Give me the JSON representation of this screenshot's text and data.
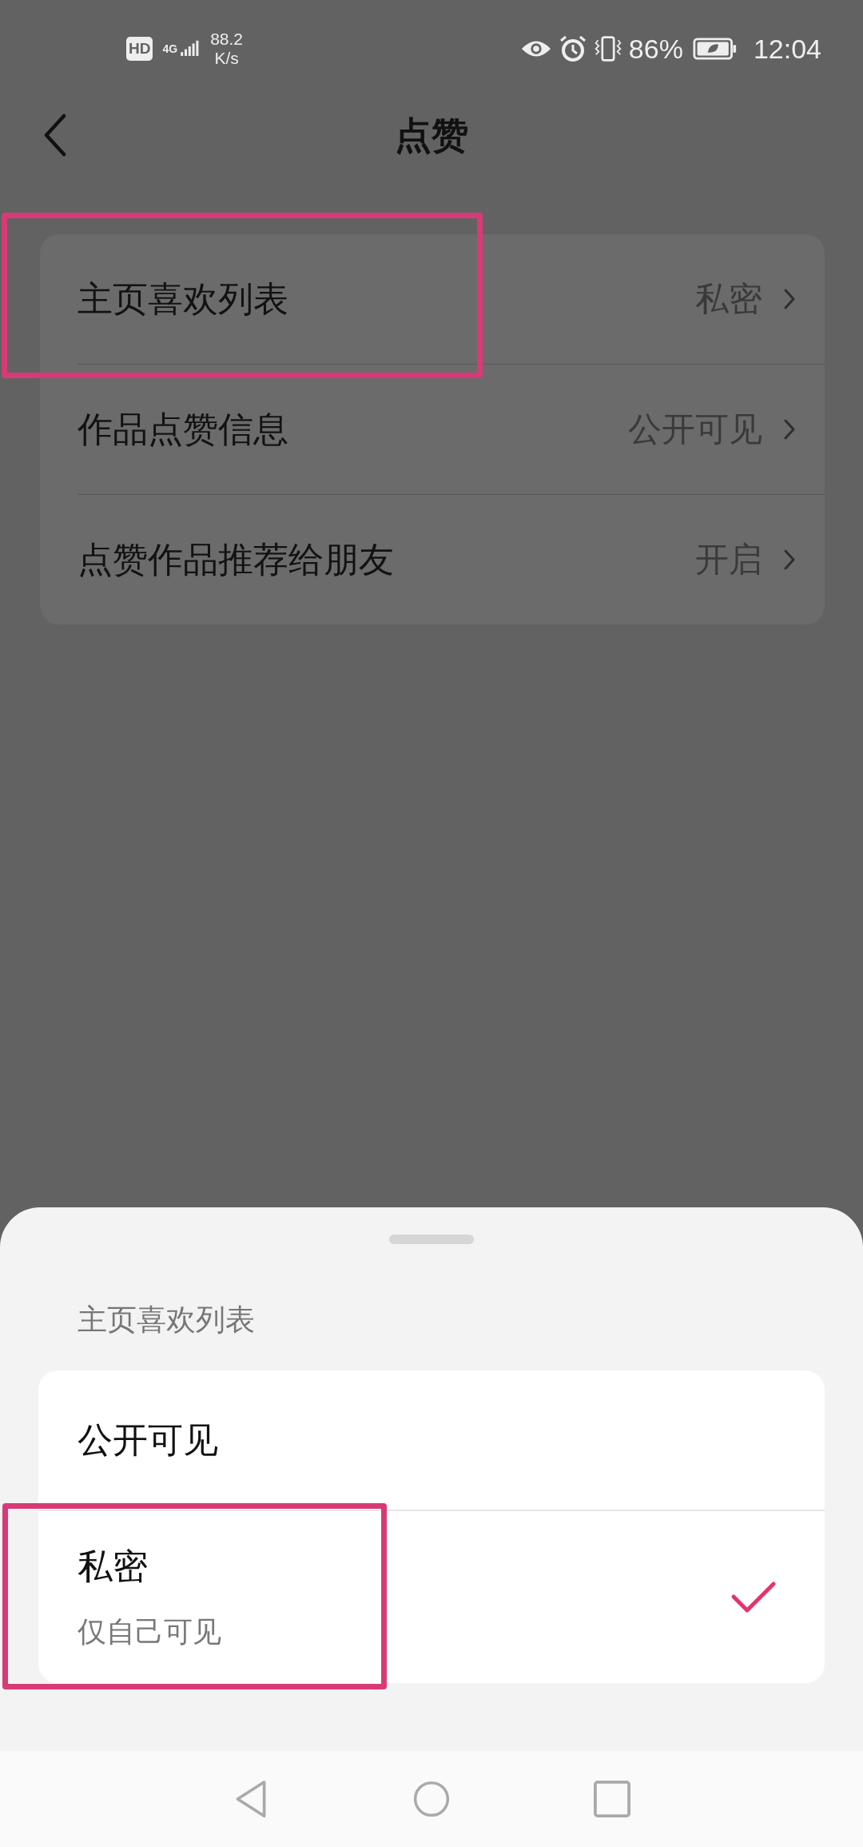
{
  "status_bar": {
    "hd_badge": "HD",
    "network": "4G",
    "speed_value": "88.2",
    "speed_unit": "K/s",
    "battery": "86%",
    "time": "12:04"
  },
  "header": {
    "title": "点赞"
  },
  "settings": [
    {
      "label": "主页喜欢列表",
      "value": "私密",
      "highlighted": true
    },
    {
      "label": "作品点赞信息",
      "value": "公开可见",
      "highlighted": false
    },
    {
      "label": "点赞作品推荐给朋友",
      "value": "开启",
      "highlighted": false
    }
  ],
  "sheet": {
    "title": "主页喜欢列表",
    "options": [
      {
        "label": "公开可见",
        "selected": false,
        "highlighted": false
      },
      {
        "label": "私密",
        "subtitle": "仅自己可见",
        "selected": true,
        "highlighted": true
      }
    ]
  }
}
